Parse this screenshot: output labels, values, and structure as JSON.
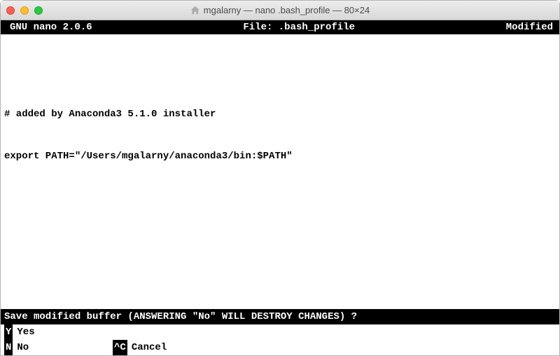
{
  "window": {
    "title": "mgalarny — nano .bash_profile — 80×24"
  },
  "nano": {
    "header": {
      "version": "GNU nano 2.0.6",
      "file_label": "File: .bash_profile",
      "status": "Modified"
    },
    "body": {
      "line1": "# added by Anaconda3 5.1.0 installer",
      "line2": "export PATH=\"/Users/mgalarny/anaconda3/bin:$PATH\""
    },
    "prompt": "Save modified buffer (ANSWERING \"No\" WILL DESTROY CHANGES) ? ",
    "shortcuts": {
      "yes": {
        "key": " Y",
        "label": "Yes"
      },
      "no": {
        "key": " N",
        "label": "No"
      },
      "cancel": {
        "key": "^C",
        "label": "Cancel"
      }
    }
  }
}
